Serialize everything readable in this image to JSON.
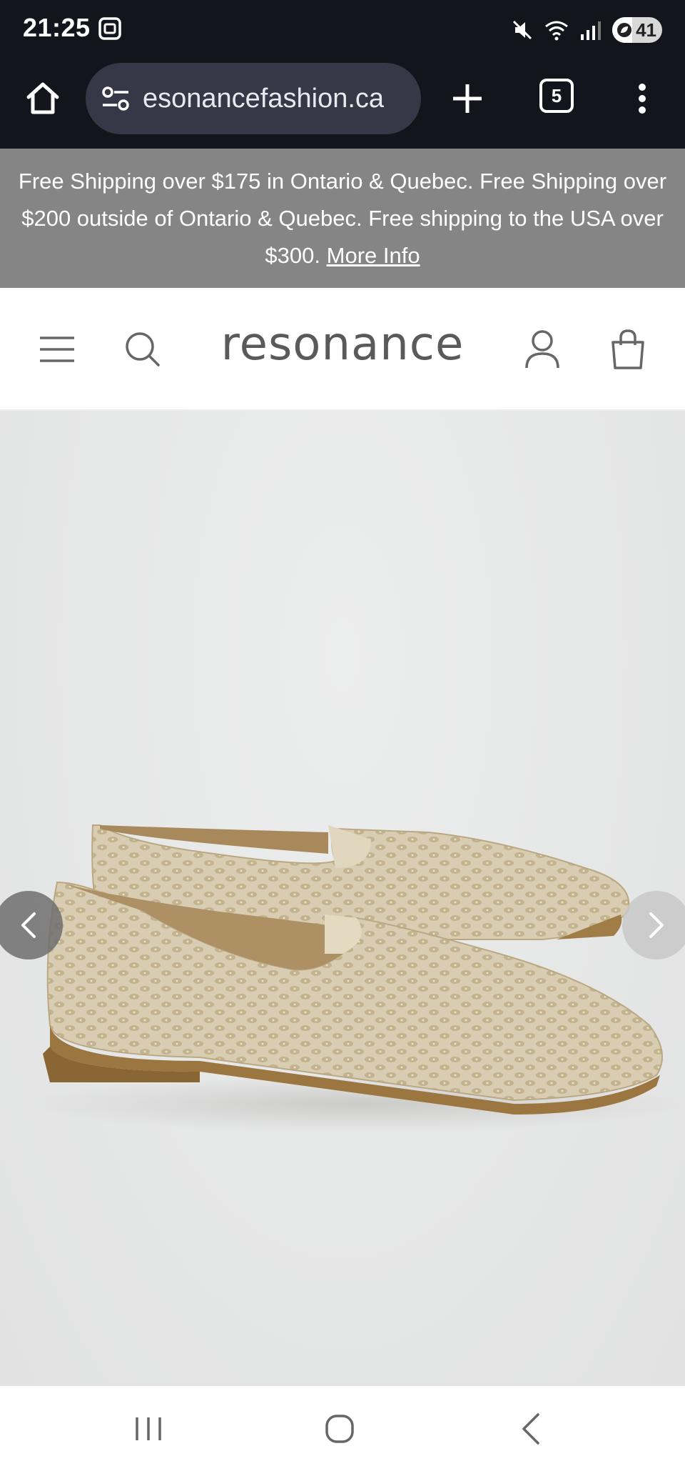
{
  "status_bar": {
    "time": "21:25",
    "battery_level": "41",
    "icons": [
      "screenshot-icon",
      "mute-icon",
      "wifi-icon",
      "signal-icon",
      "battery-icon"
    ]
  },
  "browser": {
    "url": "esonancefashion.ca",
    "tab_count": "5",
    "icons": [
      "home-icon",
      "site-settings-icon",
      "new-tab-icon",
      "tabs-icon",
      "more-menu-icon"
    ]
  },
  "announcement": {
    "text": "Free Shipping over $175 in Ontario & Quebec. Free Shipping over $200 outside of Ontario & Quebec. Free shipping to the USA over $300.",
    "link": "More Info"
  },
  "header": {
    "logo": "resonance",
    "icons": [
      "hamburger-menu-icon",
      "search-icon",
      "account-icon",
      "bag-icon"
    ]
  },
  "gallery": {
    "image_alt": "beige knit loafers",
    "icons": [
      "chevron-left-icon",
      "chevron-right-icon"
    ]
  },
  "nav": {
    "icons": [
      "recent-apps-icon",
      "home-circle-icon",
      "back-icon"
    ]
  },
  "colors": {
    "status_bg": "#14151c",
    "url_pill": "#363848",
    "announce_bg": "#858585",
    "logo_text": "#5a5a5a",
    "image_bg": "#e6e7e7"
  }
}
